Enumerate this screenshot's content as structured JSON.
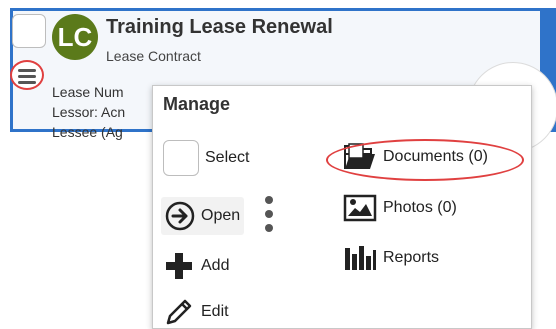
{
  "card": {
    "avatar_initials": "LC",
    "title": "Training Lease Renewal",
    "subtitle": "Lease Contract",
    "details": [
      "Lease Num",
      "Lessor: Acn",
      "Lessee (Ag"
    ]
  },
  "manage_panel": {
    "title": "Manage",
    "items": {
      "select": "Select",
      "open": "Open",
      "add": "Add",
      "edit": "Edit",
      "documents": "Documents (0)",
      "photos": "Photos (0)",
      "reports": "Reports"
    }
  },
  "colors": {
    "accent_blue": "#2f73c9",
    "avatar_green": "#5b7a1a",
    "highlight_red": "#e04040"
  },
  "icons": [
    "menu-icon",
    "arrow-circle-right-icon",
    "more-vertical-icon",
    "plus-icon",
    "pencil-icon",
    "folder-open-icon",
    "image-icon",
    "bar-chart-icon"
  ]
}
